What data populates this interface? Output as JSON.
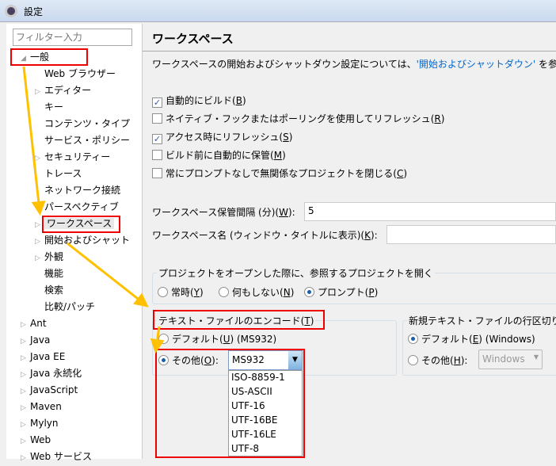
{
  "window": {
    "title": "設定",
    "icon": "gear-icon"
  },
  "tree": {
    "filter_placeholder": "フィルター入力",
    "items": [
      {
        "label": "一般",
        "level": 0,
        "expanded": true
      },
      {
        "label": "Web ブラウザー",
        "level": 1
      },
      {
        "label": "エディター",
        "level": 1,
        "expandable": true
      },
      {
        "label": "キー",
        "level": 1
      },
      {
        "label": "コンテンツ・タイプ",
        "level": 1
      },
      {
        "label": "サービス・ポリシー",
        "level": 1
      },
      {
        "label": "セキュリティー",
        "level": 1,
        "expandable": true
      },
      {
        "label": "トレース",
        "level": 1
      },
      {
        "label": "ネットワーク接続",
        "level": 1
      },
      {
        "label": "パースペクティブ",
        "level": 1
      },
      {
        "label": "ワークスペース",
        "level": 1,
        "expandable": true,
        "selected": true
      },
      {
        "label": "開始およびシャット",
        "level": 1,
        "expandable": true
      },
      {
        "label": "外観",
        "level": 1,
        "expandable": true
      },
      {
        "label": "機能",
        "level": 1
      },
      {
        "label": "検索",
        "level": 1
      },
      {
        "label": "比較/パッチ",
        "level": 1
      },
      {
        "label": "Ant",
        "level": 0,
        "expandable": true
      },
      {
        "label": "Java",
        "level": 0,
        "expandable": true
      },
      {
        "label": "Java EE",
        "level": 0,
        "expandable": true
      },
      {
        "label": "Java 永続化",
        "level": 0,
        "expandable": true
      },
      {
        "label": "JavaScript",
        "level": 0,
        "expandable": true
      },
      {
        "label": "Maven",
        "level": 0,
        "expandable": true
      },
      {
        "label": "Mylyn",
        "level": 0,
        "expandable": true
      },
      {
        "label": "Web",
        "level": 0,
        "expandable": true
      },
      {
        "label": "Web サービス",
        "level": 0,
        "expandable": true
      }
    ]
  },
  "page": {
    "title": "ワークスペース",
    "desc_prefix": "ワークスペースの開始およびシャットダウン設定については、",
    "desc_link": "'開始およびシャットダウン'",
    "desc_suffix": " を参",
    "checkboxes": [
      {
        "label": "自動的にビルド",
        "mn": "B",
        "checked": true
      },
      {
        "label": "ネイティブ・フックまたはポーリングを使用してリフレッシュ",
        "mn": "R",
        "checked": false
      },
      {
        "label": "アクセス時にリフレッシュ",
        "mn": "S",
        "checked": true
      },
      {
        "label": "ビルド前に自動的に保管",
        "mn": "M",
        "checked": false
      },
      {
        "label": "常にプロンプトなしで無関係なプロジェクトを閉じる",
        "mn": "C",
        "checked": false
      }
    ],
    "save_interval_label": "ワークスペース保管間隔 (分)",
    "save_interval_mn": "W",
    "save_interval_value": "5",
    "ws_name_label": "ワークスペース名 (ウィンドウ・タイトルに表示)",
    "ws_name_mn": "K",
    "ws_name_value": "",
    "open_group": {
      "label": "プロジェクトをオープンした際に、参照するプロジェクトを開く",
      "options": [
        {
          "label": "常時",
          "mn": "Y"
        },
        {
          "label": "何もしない",
          "mn": "N"
        },
        {
          "label": "プロンプト",
          "mn": "P",
          "selected": true
        }
      ]
    },
    "encoding_group": {
      "label": "テキスト・ファイルのエンコード",
      "mn": "T",
      "default_label": "デフォルト",
      "default_mn": "U",
      "default_value": "(MS932)",
      "other_label": "その他",
      "other_mn": "O",
      "other_selected": true,
      "combo_value": "MS932",
      "options": [
        "ISO-8859-1",
        "US-ASCII",
        "UTF-16",
        "UTF-16BE",
        "UTF-16LE",
        "UTF-8"
      ]
    },
    "line_group": {
      "label": "新規テキスト・ファイルの行区切り",
      "default_label": "デフォルト",
      "default_mn": "E",
      "default_value": "(Windows)",
      "default_selected": true,
      "other_label": "その他",
      "other_mn": "H",
      "combo_value": "Windows"
    }
  },
  "colors": {
    "highlight": "#ff0000",
    "arrow": "#ffc000",
    "link": "#0066cc"
  }
}
